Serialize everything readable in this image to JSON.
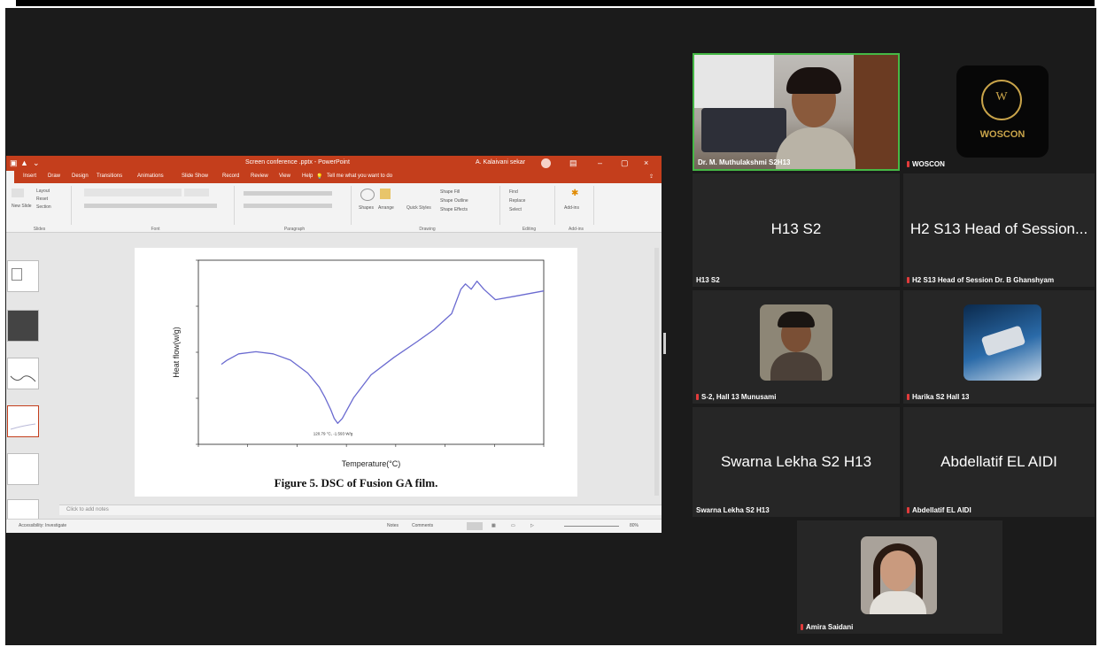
{
  "powerpoint": {
    "window_title": "Screen conference .pptx - PowerPoint",
    "user_name": "A. Kalaivani sekar",
    "tabs": [
      "Insert",
      "Draw",
      "Design",
      "Transitions",
      "Animations",
      "Slide Show",
      "Record",
      "Review",
      "View",
      "Help"
    ],
    "tell_me": "Tell me what you want to do",
    "ribbon_groups": [
      "Slides",
      "Font",
      "Paragraph",
      "Drawing",
      "Editing",
      "Add-ins"
    ],
    "ribbon_items": {
      "layout": "Layout",
      "reset": "Reset",
      "section": "Section",
      "new_slide": "New Slide",
      "shapes": "Shapes",
      "arrange": "Arrange",
      "quick_styles": "Quick Styles",
      "shape_fill": "Shape Fill",
      "shape_outline": "Shape Outline",
      "shape_effects": "Shape Effects",
      "find": "Find",
      "replace": "Replace",
      "select": "Select",
      "add_ins": "Add-ins"
    },
    "notes_placeholder": "Click to add notes",
    "status_left": "Accessibility: Investigate",
    "status_notes": "Notes",
    "status_comments": "Comments",
    "zoom": "80%"
  },
  "slide": {
    "caption": "Figure 5. DSC of Fusion GA film.",
    "annotation": "120.79 °C, -1.593 W/g"
  },
  "chart_data": {
    "type": "line",
    "xlabel": "Temperature(°C)",
    "ylabel": "Heat flow(w/g)",
    "xlim": [
      0,
      300
    ],
    "x_ticks": [],
    "series": [
      {
        "x": [
          20,
          25,
          35,
          50,
          65,
          80,
          95,
          105,
          110,
          115,
          118,
          121,
          125,
          135,
          150,
          170,
          190,
          205,
          220,
          228,
          232,
          237,
          242,
          248,
          258,
          275,
          300
        ],
        "y": [
          0.1,
          0.22,
          0.4,
          0.46,
          0.4,
          0.22,
          -0.15,
          -0.55,
          -0.85,
          -1.2,
          -1.45,
          -1.59,
          -1.45,
          -0.85,
          -0.2,
          0.3,
          0.75,
          1.1,
          1.55,
          2.25,
          2.4,
          2.25,
          2.48,
          2.25,
          1.95,
          2.05,
          2.2
        ]
      }
    ]
  },
  "participants": [
    {
      "name": "Dr. M. Muthulakshmi S2H13",
      "center": "",
      "muted": false,
      "video": true,
      "active": true
    },
    {
      "name": "WOSCON",
      "center": "",
      "muted": true,
      "video": false,
      "logo": "WOSCON"
    },
    {
      "name": "H13 S2",
      "center": "H13 S2",
      "muted": false
    },
    {
      "name": "H2 S13 Head of Session Dr. B Ghanshyam",
      "center": "H2 S13 Head of Session...",
      "muted": true
    },
    {
      "name": "S-2, Hall 13 Munusami",
      "center": "",
      "muted": true
    },
    {
      "name": "Harika S2 Hall 13",
      "center": "",
      "muted": true
    },
    {
      "name": "Swarna Lekha S2 H13",
      "center": "Swarna Lekha S2 H13",
      "muted": false
    },
    {
      "name": "Abdellatif EL AIDI",
      "center": "Abdellatif EL AIDI",
      "muted": true
    },
    {
      "name": "Amira Saidani",
      "center": "",
      "muted": true
    }
  ],
  "colors": {
    "ppt_accent": "#c43e1c",
    "active_speaker": "#45b845",
    "mic_muted": "#e23b3b",
    "meeting_bg": "#1b1b1b",
    "tile_bg": "#262626"
  }
}
